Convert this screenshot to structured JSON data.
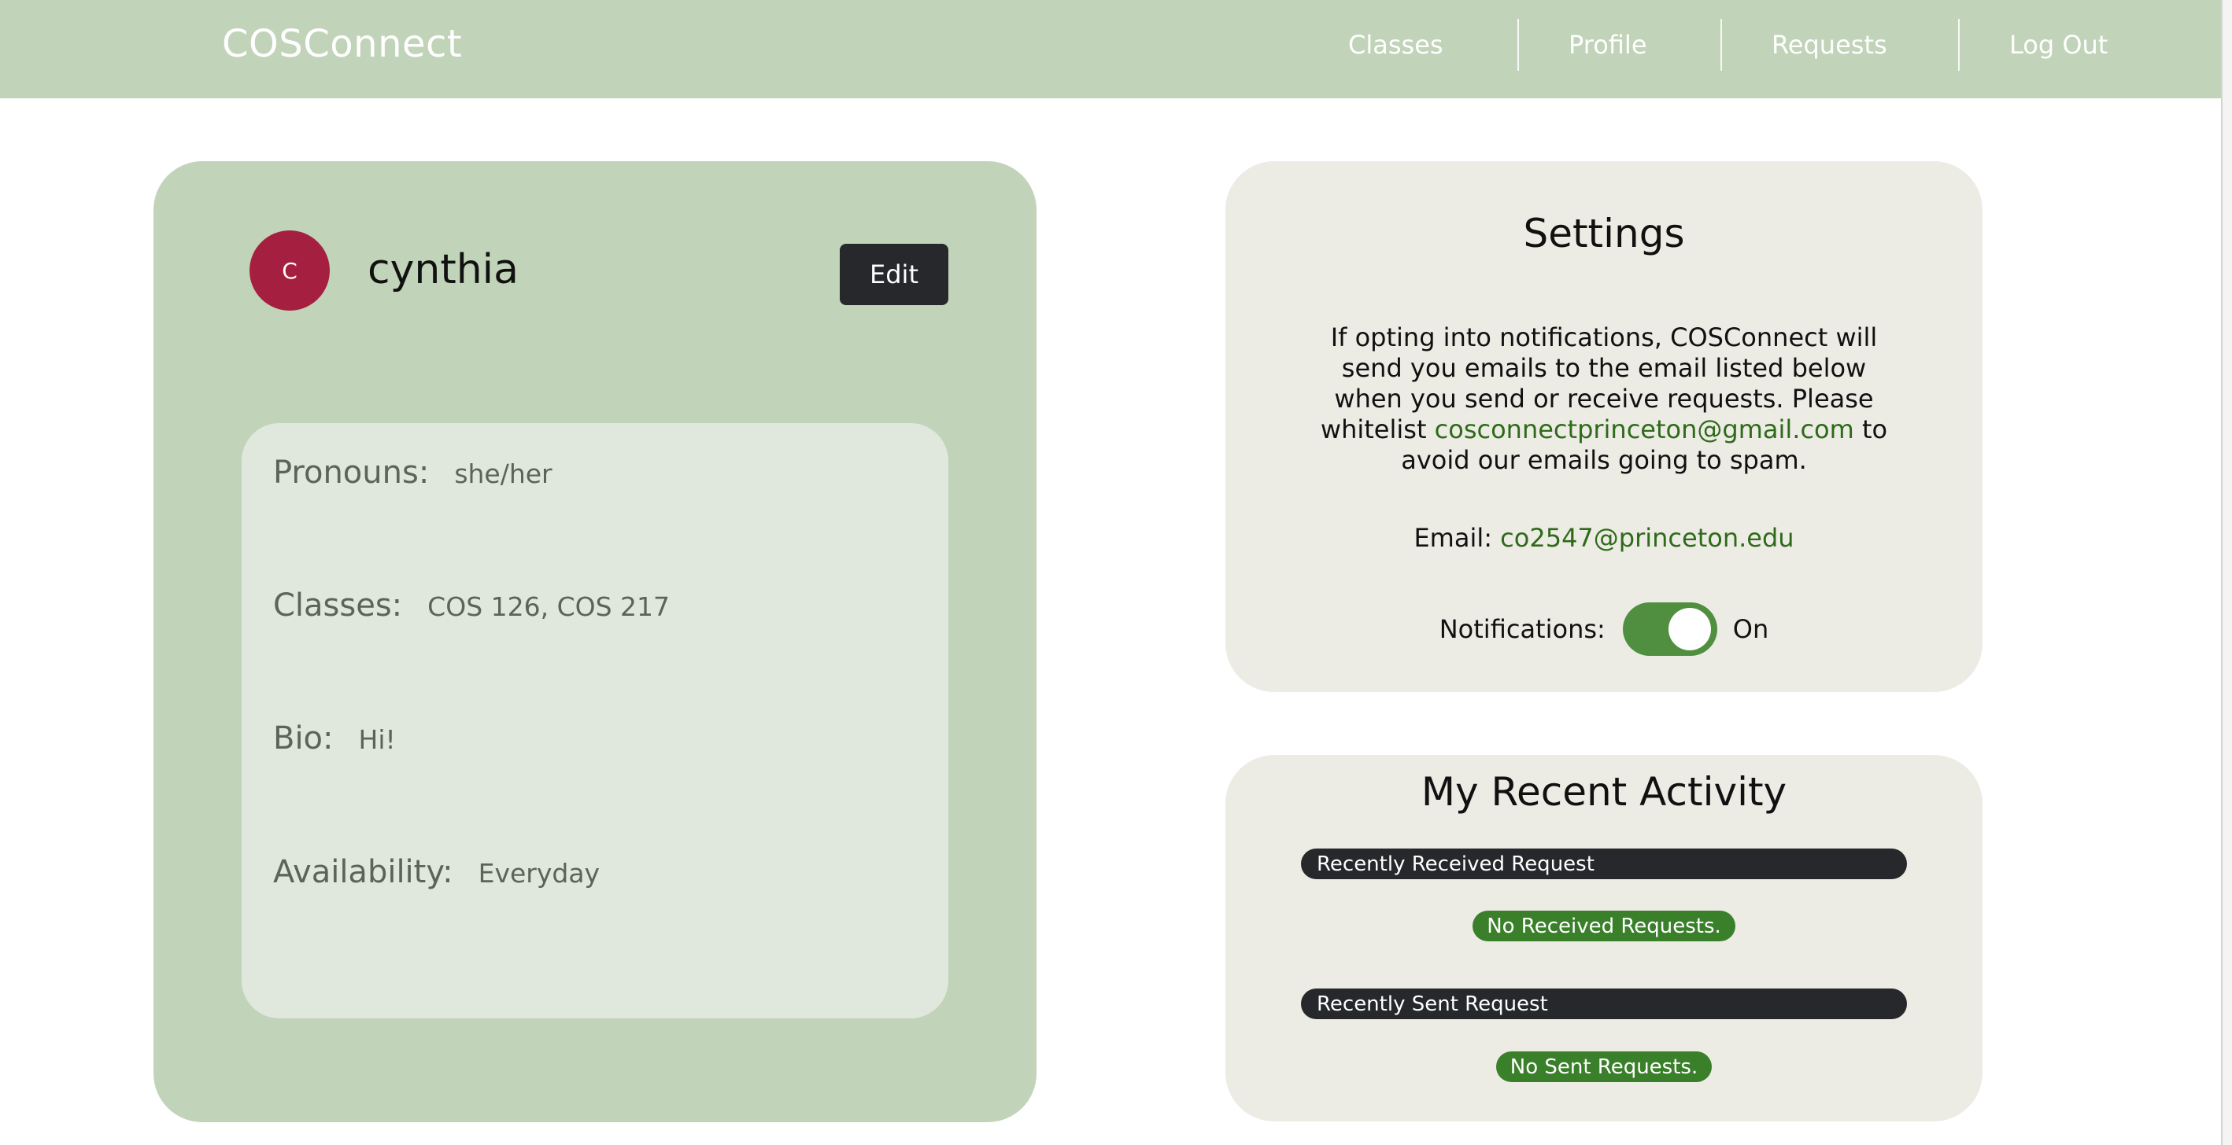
{
  "navbar": {
    "brand": "COSConnect",
    "links": [
      "Classes",
      "Profile",
      "Requests",
      "Log Out"
    ]
  },
  "profile": {
    "avatar_initial": "C",
    "username": "cynthia",
    "edit_label": "Edit",
    "fields": [
      {
        "label": "Pronouns:",
        "value": "she/her"
      },
      {
        "label": "Classes:",
        "value": "COS 126, COS 217"
      },
      {
        "label": "Bio:",
        "value": "Hi!"
      },
      {
        "label": "Availability:",
        "value": "Everyday"
      }
    ]
  },
  "settings": {
    "title": "Settings",
    "desc_before": "If opting into notifications, COSConnect will send you emails to the email listed below when you send or receive requests. Please whitelist",
    "whitelist_email": "cosconnectprinceton@gmail.com",
    "desc_after": "to avoid our emails going to spam.",
    "email_label": "Email:",
    "email_value": "co2547@princeton.edu",
    "notifications_label": "Notifications:",
    "notifications_state": "On",
    "toggle_color": "#4f8f3f"
  },
  "activity": {
    "title": "My Recent Activity",
    "received_header": "Recently Received Request",
    "received_empty": "No Received Requests.",
    "sent_header": "Recently Sent Request",
    "sent_empty": "No Sent Requests."
  },
  "colors": {
    "nav_bg": "#c1d3b8",
    "card_green": "#c1d3b8",
    "card_beige": "#ecebe4",
    "avatar": "#a52040",
    "accent_green": "#3a7f2a",
    "dark": "#26282b"
  }
}
